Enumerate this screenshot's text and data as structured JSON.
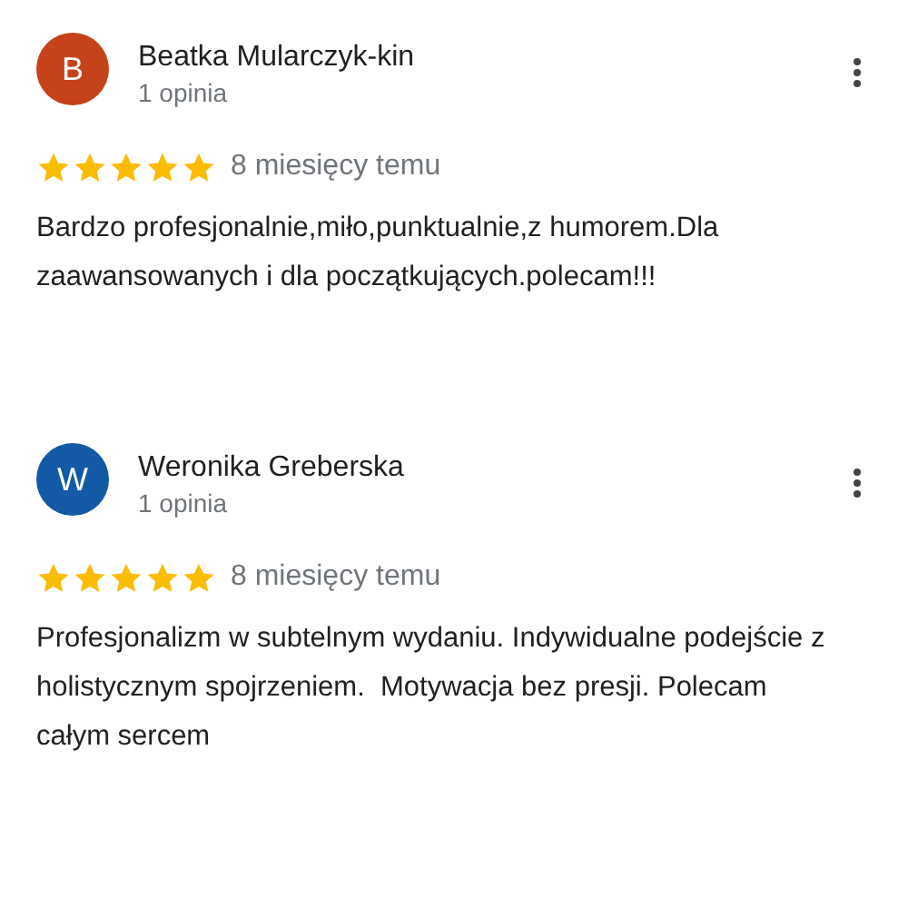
{
  "reviews": [
    {
      "initial": "B",
      "color": "#c5421a",
      "name": "Beatka Mularczyk-kin",
      "count": "1 opinia",
      "stars": 5,
      "time": "8 miesięcy temu",
      "text": "Bardzo profesjonalnie,miło,punktualnie,z humorem.Dla zaawansowanych i dla początkujących.polecam!!!"
    },
    {
      "initial": "W",
      "color": "#1459a5",
      "name": "Weronika Greberska",
      "count": "1 opinia",
      "stars": 5,
      "time": "8 miesięcy temu",
      "text": "Profesjonalizm w subtelnym wydaniu. Indywidualne podejście z holistycznym spojrzeniem.  Motywacja bez presji. Polecam całym sercem"
    }
  ]
}
